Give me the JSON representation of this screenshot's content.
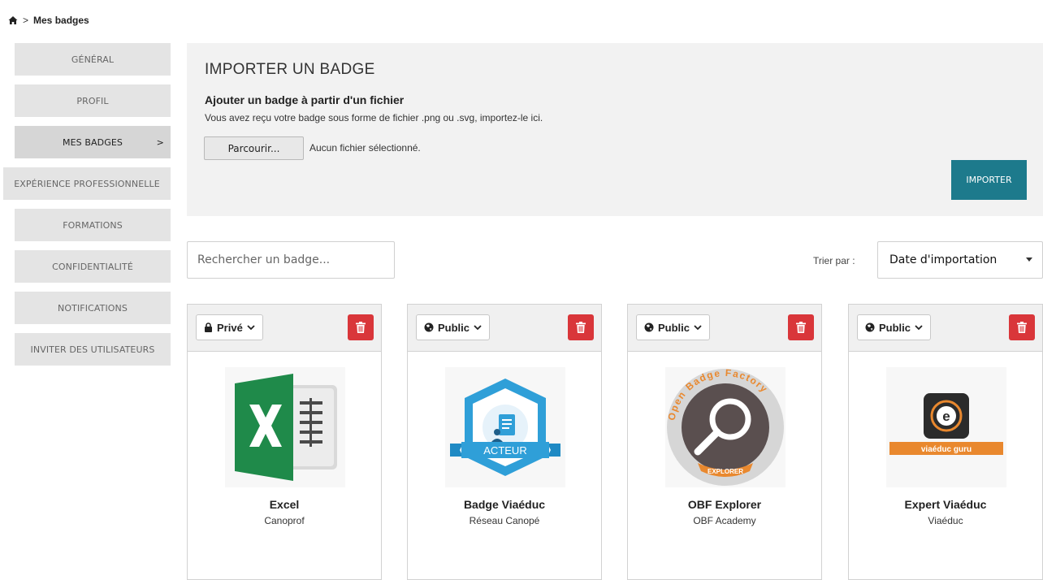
{
  "breadcrumb": {
    "home_icon": "home-icon",
    "separator": ">",
    "current": "Mes badges"
  },
  "sidebar": {
    "items": [
      {
        "label": "GÉNÉRAL"
      },
      {
        "label": "PROFIL"
      },
      {
        "label": "MES BADGES",
        "active": true,
        "chevron": ">"
      },
      {
        "label": "EXPÉRIENCE PROFESSIONNELLE"
      },
      {
        "label": "FORMATIONS"
      },
      {
        "label": "CONFIDENTIALITÉ"
      },
      {
        "label": "NOTIFICATIONS"
      },
      {
        "label": "INVITER DES UTILISATEURS"
      }
    ]
  },
  "import": {
    "title": "IMPORTER UN BADGE",
    "subtitle": "Ajouter un badge à partir d'un fichier",
    "description": "Vous avez reçu votre badge sous forme de fichier .png ou .svg, importez-le ici.",
    "browse_label": "Parcourir...",
    "file_status": "Aucun fichier sélectionné.",
    "import_label": "IMPORTER"
  },
  "search": {
    "placeholder": "Rechercher un badge..."
  },
  "sort": {
    "label": "Trier par :",
    "selected": "Date d'importation"
  },
  "badges": [
    {
      "visibility": "Privé",
      "visibility_icon": "lock-icon",
      "name": "Excel",
      "issuer": "Canoprof",
      "image": "excel-badge"
    },
    {
      "visibility": "Public",
      "visibility_icon": "globe-icon",
      "name": "Badge Viaéduc",
      "issuer": "Réseau Canopé",
      "image": "acteur-badge",
      "image_text": "ACTEUR"
    },
    {
      "visibility": "Public",
      "visibility_icon": "globe-icon",
      "name": "OBF Explorer",
      "issuer": "OBF Academy",
      "image": "obf-explorer-badge",
      "image_text": "EXPLORER",
      "ring_text": "Open Badge Factory"
    },
    {
      "visibility": "Public",
      "visibility_icon": "globe-icon",
      "name": "Expert Viaéduc",
      "issuer": "Viaéduc",
      "image": "viaeduc-guru-badge",
      "image_text": "viaéduc guru"
    }
  ],
  "colors": {
    "accent": "#1d7a8c",
    "danger": "#d9363a",
    "panel": "#f2f2f2",
    "sidebar": "#e4e4e4"
  }
}
